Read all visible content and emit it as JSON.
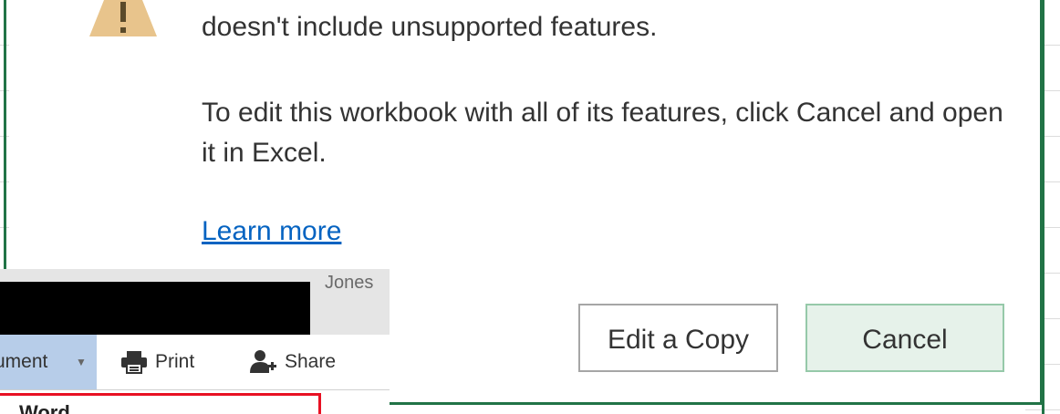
{
  "dialog": {
    "message_line1": "doesn't include unsupported features.",
    "message_line2": "To edit this workbook with all of its features, click Cancel and open it in Excel.",
    "learn_more": "Learn more",
    "edit_copy_label": "Edit a Copy",
    "cancel_label": "Cancel",
    "warning_icon": "warning-icon"
  },
  "inset": {
    "user_text": "Jones",
    "document_menu": "ument",
    "print_label": "Print",
    "share_label": "Share",
    "menu_item_partial": "Word"
  },
  "colors": {
    "excel_green": "#217346",
    "cancel_bg": "#e6f2ea",
    "link": "#0563c1",
    "highlight_red": "#e81123"
  }
}
